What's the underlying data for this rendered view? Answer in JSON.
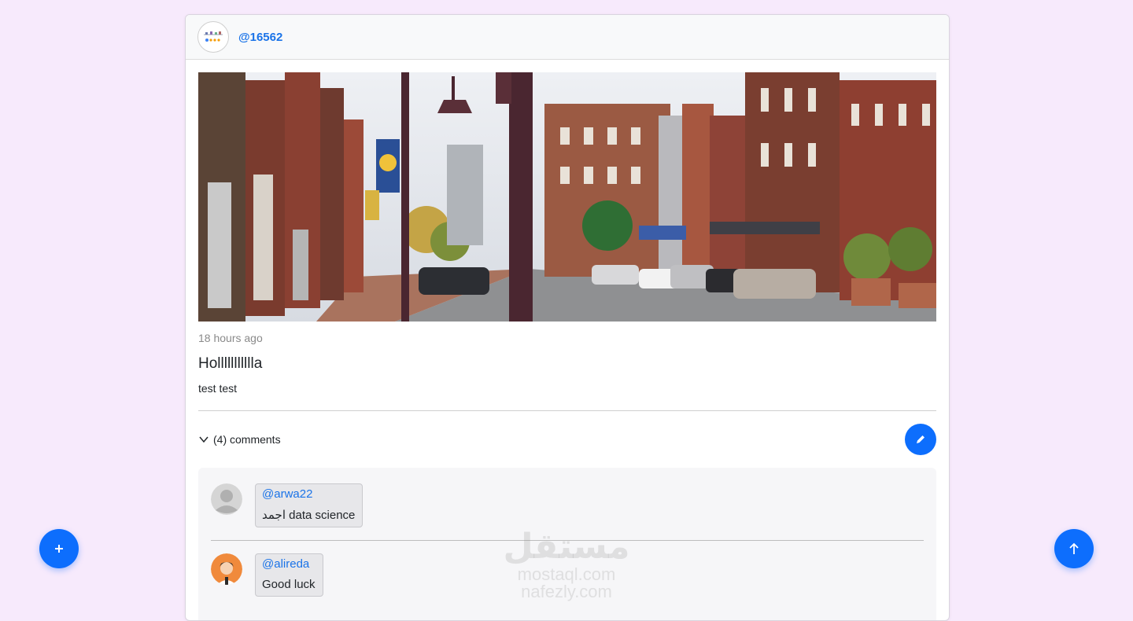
{
  "post": {
    "username": "@16562",
    "time_ago": "18 hours ago",
    "title": "Hollllllllllla",
    "body": "test test",
    "comments_toggle": "(4) comments"
  },
  "comments": [
    {
      "user": "@arwa22",
      "text": "اجمد data science"
    },
    {
      "user": "@alireda",
      "text": "Good luck"
    }
  ],
  "watermark": {
    "logo": "مستقل",
    "line1": "mostaql.com",
    "line2": "nafezly.com"
  },
  "colors": {
    "accent": "#0d6efd",
    "link": "#1a73e8",
    "page_background": "#f7eafc"
  },
  "icons": {
    "toggle": "chevron-down-icon",
    "edit": "pencil-icon",
    "add": "plus-icon",
    "scroll_top": "arrow-up-icon"
  }
}
